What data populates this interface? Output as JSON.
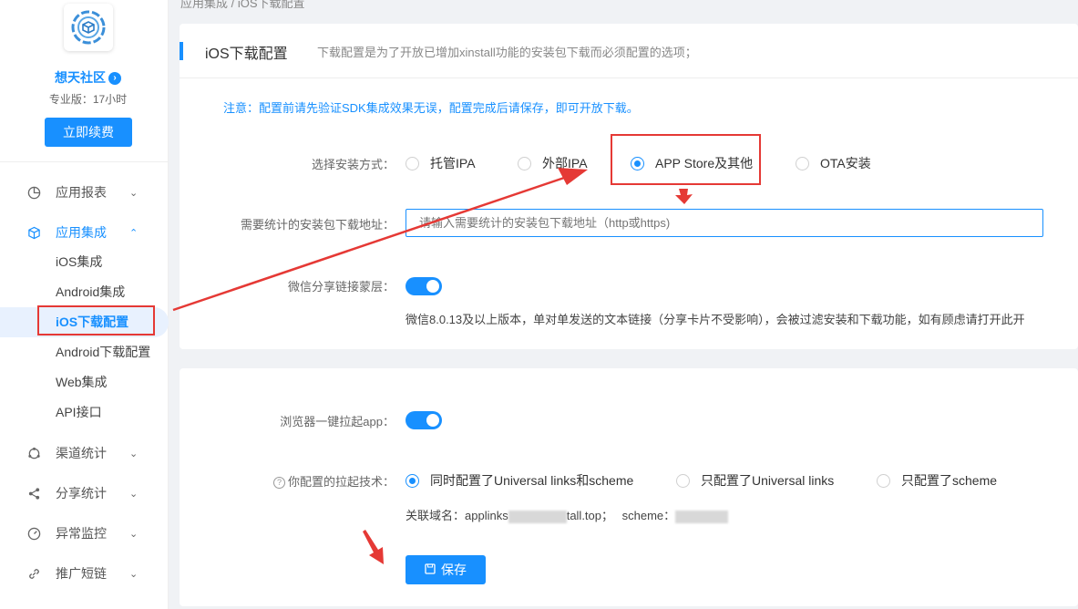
{
  "breadcrumb": {
    "parent": "应用集成",
    "separator": "/",
    "current": "iOS下载配置"
  },
  "sidebar": {
    "brand": "想天社区",
    "brand_badge": "›",
    "plan": "专业版：17小时",
    "renew_label": "立即续费",
    "groups": [
      {
        "label": "应用报表",
        "icon": "pie-chart-icon",
        "chevron": "⌄"
      },
      {
        "label": "应用集成",
        "icon": "cube-icon",
        "chevron": "⌃"
      },
      {
        "label": "渠道统计",
        "icon": "channel-icon",
        "chevron": "⌄"
      },
      {
        "label": "分享统计",
        "icon": "share-icon",
        "chevron": "⌄"
      },
      {
        "label": "异常监控",
        "icon": "gauge-icon",
        "chevron": "⌄"
      },
      {
        "label": "推广短链",
        "icon": "link-icon",
        "chevron": "⌄"
      }
    ],
    "sub_items": [
      "iOS集成",
      "Android集成",
      "iOS下载配置",
      "Android下载配置",
      "Web集成",
      "API接口"
    ]
  },
  "panel1": {
    "title": "iOS下载配置",
    "desc": "下载配置是为了开放已增加xinstall功能的安装包下载而必须配置的选项；",
    "notice": "注意：配置前请先验证SDK集成效果无误，配置完成后请保存，即可开放下载。",
    "install_label": "选择安装方式：",
    "install_options": [
      "托管IPA",
      "外部IPA",
      "APP Store及其他",
      "OTA安装"
    ],
    "install_selected": "APP Store及其他",
    "url_label": "需要统计的安装包下载地址：",
    "url_placeholder": "请输入需要统计的安装包下载地址（http或https)",
    "wechat_label": "微信分享链接蒙层：",
    "wechat_note": "微信8.0.13及以上版本，单对单发送的文本链接（分享卡片不受影响），会被过滤安装和下载功能，如有顾虑请打开此开"
  },
  "panel2": {
    "browser_label": "浏览器一键拉起app：",
    "help_icon": "?",
    "tech_label": "你配置的拉起技术：",
    "tech_options": [
      "同时配置了Universal links和scheme",
      "只配置了Universal links",
      "只配置了scheme"
    ],
    "tech_selected": "同时配置了Universal links和scheme",
    "domain_prefix": "关联域名：applinks",
    "domain_suffix": "tall.top；",
    "scheme_prefix": "scheme：",
    "save_label": "保存"
  },
  "colors": {
    "accent": "#1890ff",
    "annotation": "#e53935"
  }
}
